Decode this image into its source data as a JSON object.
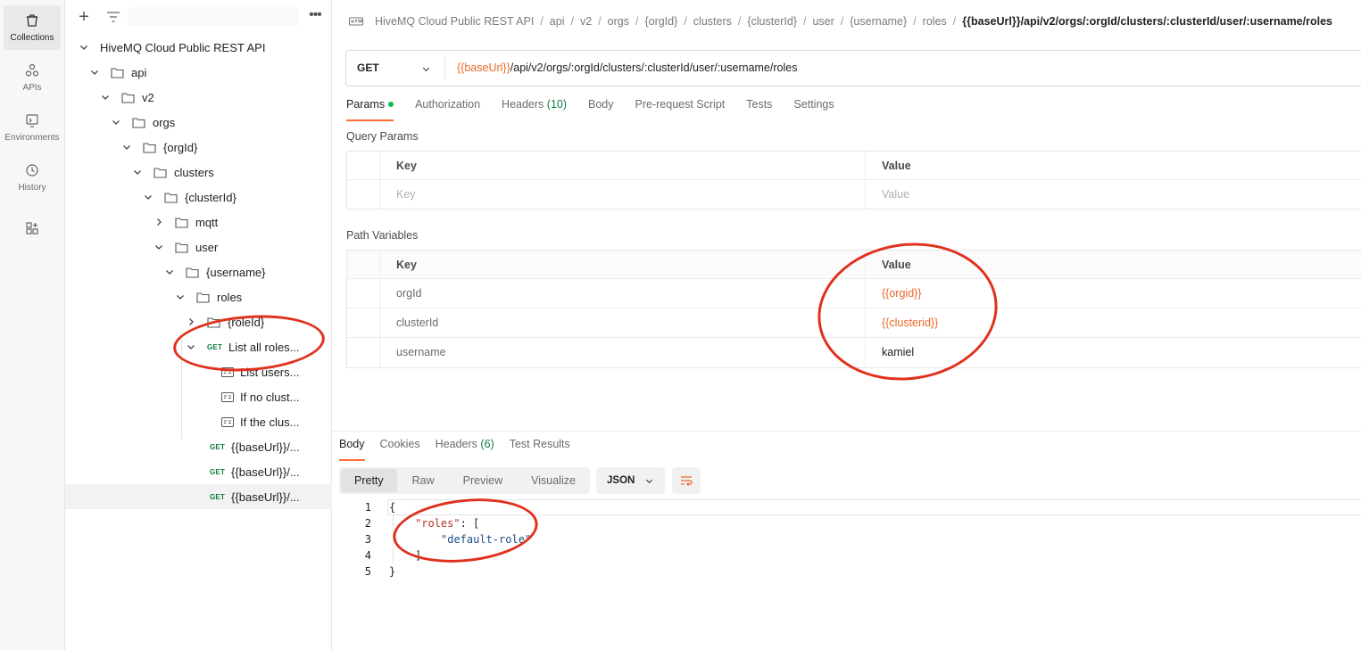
{
  "rail": [
    {
      "label": "Collections",
      "icon": "trash-can-icon",
      "active": true
    },
    {
      "label": "APIs",
      "icon": "apis-icon"
    },
    {
      "label": "Environments",
      "icon": "environments-icon"
    },
    {
      "label": "History",
      "icon": "history-icon"
    }
  ],
  "sidebar": {
    "tree": [
      "HiveMQ Cloud Public REST API",
      "api",
      "v2",
      "orgs",
      "{orgId}",
      "clusters",
      "{clusterId}",
      "mqtt",
      "user",
      "{username}",
      "roles",
      "{roleId}",
      "List all roles...",
      "List users...",
      "If no clust...",
      "If the clus...",
      "{{baseUrl}}/...",
      "{{baseUrl}}/...",
      "{{baseUrl}}/..."
    ],
    "method_get": "GET"
  },
  "breadcrumb": {
    "segments": [
      "HiveMQ Cloud Public REST API",
      "api",
      "v2",
      "orgs",
      "{orgId}",
      "clusters",
      "{clusterId}",
      "user",
      "{username}",
      "roles"
    ],
    "separator": "/",
    "current": "{{baseUrl}}/api/v2/orgs/:orgId/clusters/:clusterId/user/:username/roles"
  },
  "request": {
    "method": "GET",
    "url_var": "{{baseUrl}}",
    "url_rest": "/api/v2/orgs/:orgId/clusters/:clusterId/user/:username/roles"
  },
  "tabs": {
    "params": "Params",
    "authorization": "Authorization",
    "headers": "Headers",
    "headers_count": "(10)",
    "body": "Body",
    "prerequest": "Pre-request Script",
    "tests": "Tests",
    "settings": "Settings"
  },
  "query_params": {
    "title": "Query Params",
    "key_header": "Key",
    "value_header": "Value",
    "key_placeholder": "Key",
    "value_placeholder": "Value"
  },
  "path_variables": {
    "title": "Path Variables",
    "key_header": "Key",
    "value_header": "Value",
    "rows": [
      {
        "key": "orgId",
        "value": "{{orgid}}"
      },
      {
        "key": "clusterId",
        "value": "{{clusterid}}"
      },
      {
        "key": "username",
        "value": "kamiel"
      }
    ]
  },
  "response": {
    "tabs": {
      "body": "Body",
      "cookies": "Cookies",
      "headers": "Headers",
      "headers_count": "(6)",
      "test_results": "Test Results"
    },
    "views": [
      "Pretty",
      "Raw",
      "Preview",
      "Visualize"
    ],
    "format": "JSON",
    "line_numbers": [
      "1",
      "2",
      "3",
      "4",
      "5"
    ],
    "lines": {
      "l1": "{",
      "l2_key": "\"roles\"",
      "l2_rest": ": [",
      "l3_val": "\"default-role\"",
      "l4": "]",
      "l5": "}"
    }
  },
  "colors": {
    "accent": "#ff6c37",
    "variable": "#e8692a",
    "get_method": "#0f7b3f",
    "annotation": "#e0311e"
  }
}
